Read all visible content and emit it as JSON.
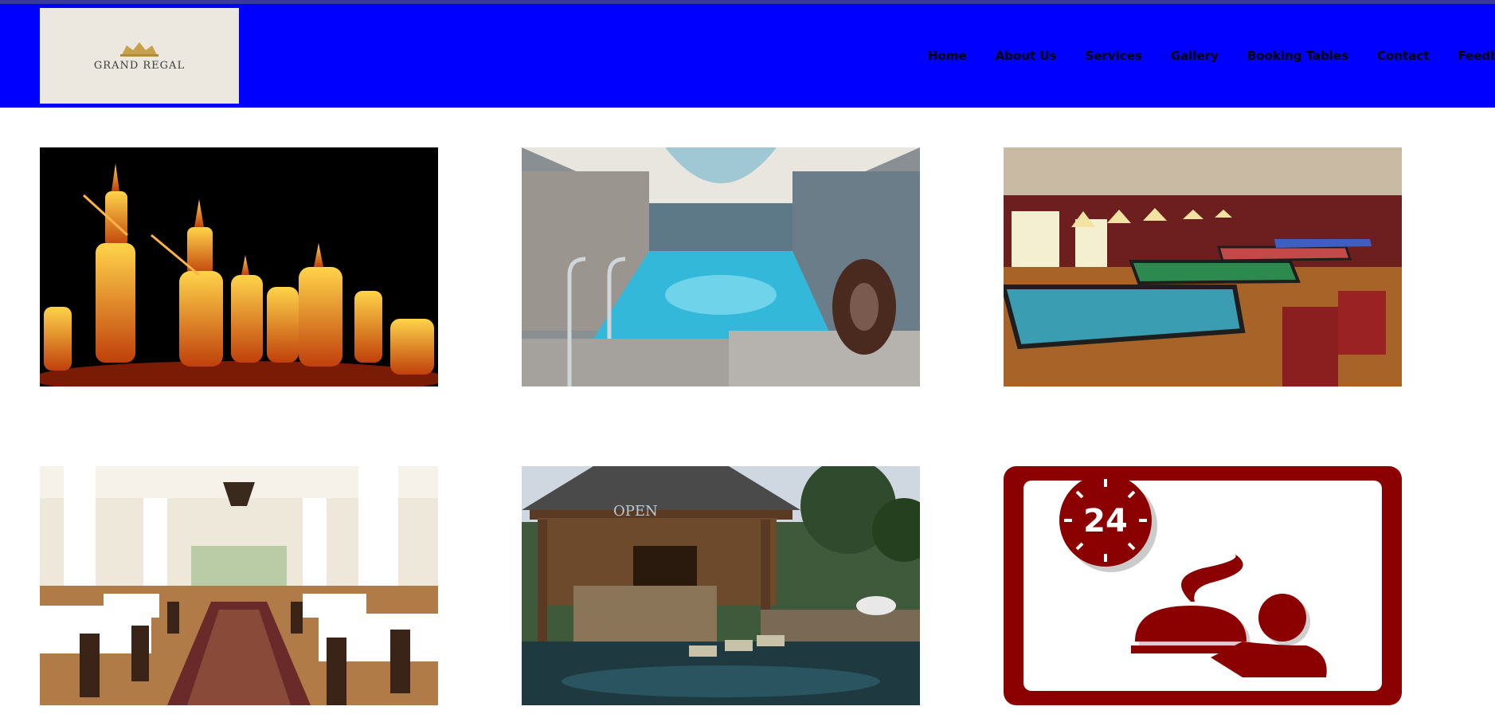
{
  "header": {
    "logo_text": "GRAND REGAL",
    "nav": {
      "home": "Home",
      "about": "About Us",
      "services": "Services",
      "gallery": "Gallery",
      "booking": "Booking Tables",
      "contact": "Contact",
      "feedback": "Feedback"
    }
  },
  "colors": {
    "header_bg": "#0000ff",
    "room_service_red": "#8b0000"
  },
  "gallery": {
    "room_service_icon": {
      "clock_label": "24",
      "icon": "room-service-24h-icon"
    },
    "gazebo_sign": "OPEN"
  }
}
